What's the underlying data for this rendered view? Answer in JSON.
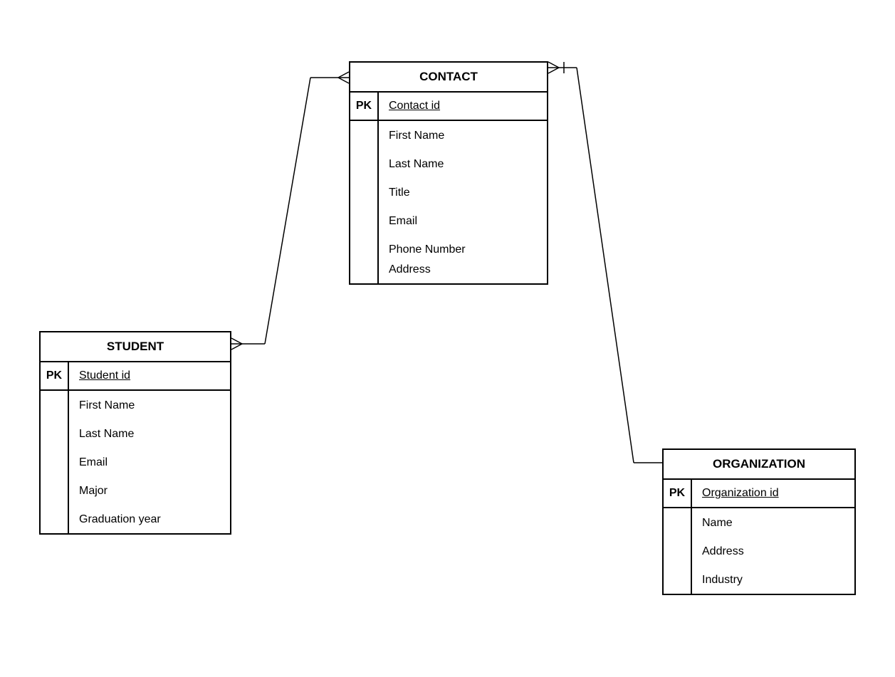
{
  "entities": {
    "student": {
      "title": "STUDENT",
      "pk_label": "PK",
      "pk_field": "Student id",
      "attributes": [
        "First Name",
        "Last Name",
        "Email",
        "Major",
        "Graduation year"
      ]
    },
    "contact": {
      "title": "CONTACT",
      "pk_label": "PK",
      "pk_field": "Contact id",
      "attributes": [
        "First Name",
        "Last Name",
        "Title",
        "Email",
        "Phone Number",
        "Address"
      ]
    },
    "organization": {
      "title": "ORGANIZATION",
      "pk_label": "PK",
      "pk_field": "Organization id",
      "attributes": [
        "Name",
        "Address",
        "Industry"
      ]
    }
  },
  "relationships": [
    {
      "from": "student",
      "to": "contact",
      "from_side": "right",
      "to_side": "left",
      "from_notation": "crowfoot",
      "to_notation": "crowfoot"
    },
    {
      "from": "contact",
      "to": "organization",
      "from_side": "right",
      "to_side": "left",
      "from_notation": "one-or-many",
      "to_notation": "none"
    }
  ]
}
